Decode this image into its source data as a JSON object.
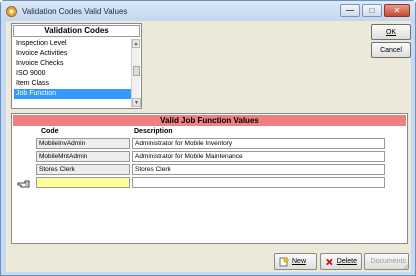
{
  "window": {
    "title": "Validation Codes Valid Values",
    "minimize_glyph": "—",
    "restore_glyph": "□",
    "close_glyph": "✕"
  },
  "codes": {
    "header": "Validation Codes",
    "items": [
      {
        "label": "Inspection Level"
      },
      {
        "label": "Invoice Activities"
      },
      {
        "label": "Invoice Checks"
      },
      {
        "label": "ISO 9000"
      },
      {
        "label": "Item Class"
      },
      {
        "label": "Job Function",
        "selected": true
      }
    ]
  },
  "buttons": {
    "ok_label": "OK",
    "cancel_label": "Cancel",
    "new_label": "New",
    "delete_label": "Delete",
    "documents_label": "Documents"
  },
  "values": {
    "header": "Valid Job Function Values",
    "col_code": "Code",
    "col_description": "Description",
    "rows": [
      {
        "code": "MobileInvAdmin",
        "description": "Administrator for Mobile Inventory"
      },
      {
        "code": "MobileMntAdmin",
        "description": "Administrator for Mobile Maintenance"
      },
      {
        "code": "Stores Clerk",
        "description": "Stores Clerk"
      },
      {
        "code": "",
        "description": ""
      }
    ]
  },
  "colors": {
    "values_header_bg": "#f08080",
    "selection_bg": "#3399ff",
    "new_row_code_bg": "#ffff99",
    "window_frame": "#c5d9f1"
  }
}
